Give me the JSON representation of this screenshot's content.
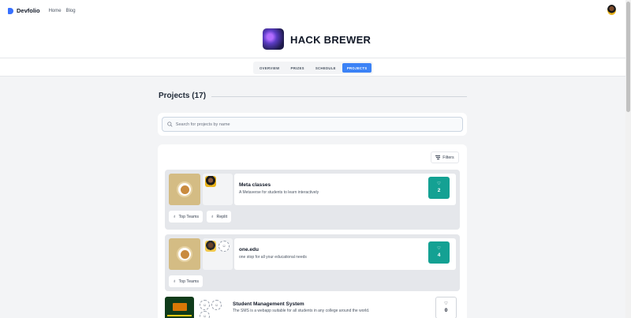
{
  "header": {
    "brand": "Devfolio",
    "nav": [
      "Home",
      "Blog"
    ]
  },
  "hackathon": {
    "title": "HACK BREWER"
  },
  "tabs": [
    {
      "label": "OVERVIEW",
      "active": false
    },
    {
      "label": "PRIZES",
      "active": false
    },
    {
      "label": "SCHEDULE",
      "active": false
    },
    {
      "label": "PROJECTS",
      "active": true
    }
  ],
  "projects_section": {
    "heading": "Projects (17)",
    "search_placeholder": "Search for projects by name",
    "filters_label": "Filters"
  },
  "projects": [
    {
      "name": "Meta classes",
      "description": "A Metaverse for students to learn interactively",
      "likes": "2",
      "liked": true,
      "tags": [
        "Top Teams",
        "Replit"
      ]
    },
    {
      "name": "one.edu",
      "description": "one stop for all your educational needs",
      "likes": "4",
      "liked": true,
      "tags": [
        "Top Teams"
      ]
    },
    {
      "name": "Student Management System",
      "description": "The SMS is a webapp suitable for all students in any college around the world.",
      "likes": "0",
      "liked": false,
      "tags": []
    }
  ],
  "colors": {
    "accent": "#3b82f6",
    "like_active": "#14a193",
    "brand": "#3770ff"
  }
}
